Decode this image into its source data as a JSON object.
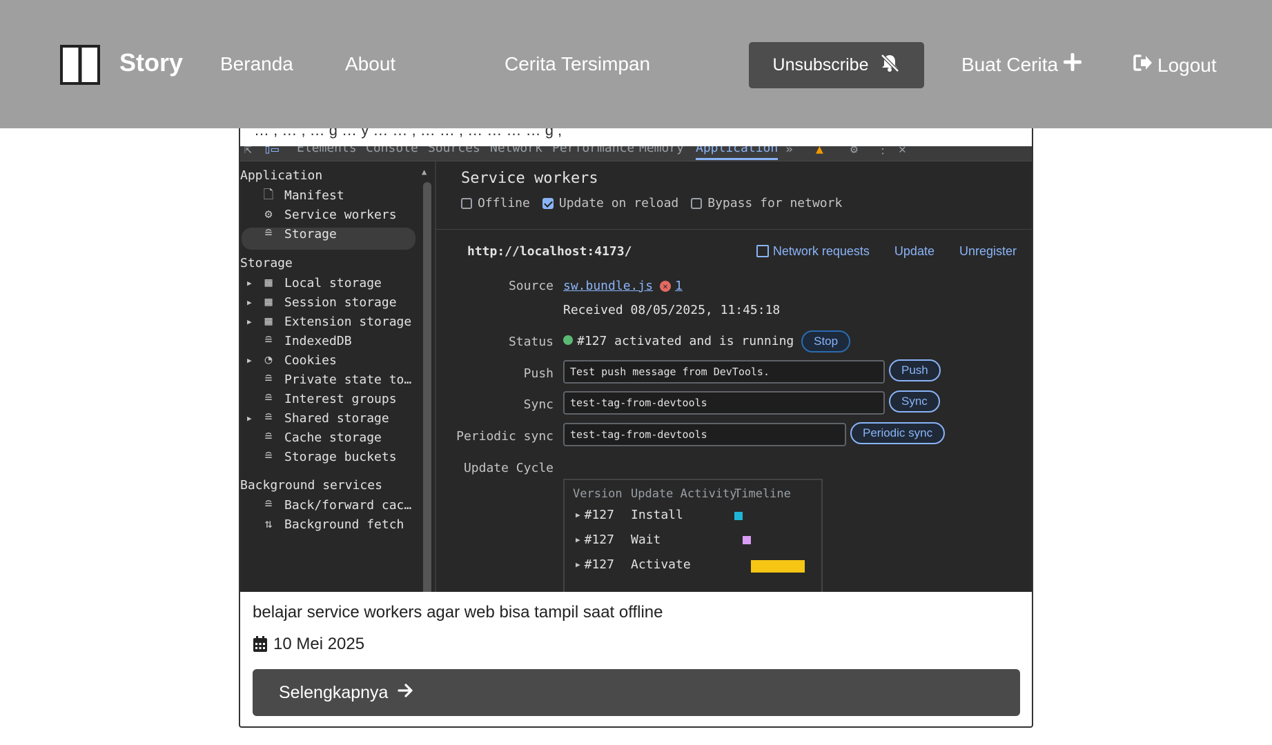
{
  "header": {
    "brand": "Story",
    "nav": [
      "Beranda",
      "About",
      "Cerita Tersimpan"
    ],
    "unsubscribe_label": "Unsubscribe",
    "create_label": "Buat Cerita",
    "logout_label": "Logout",
    "icons": {
      "logo": "book-open-icon",
      "unsubscribe": "bell-slash-icon",
      "create": "plus-icon",
      "logout": "sign-out-icon"
    },
    "colors": {
      "header_bg": "#9f9f9f",
      "button_bg": "#4d4d4d",
      "text": "#ffffff"
    }
  },
  "card": {
    "overflow_text": "… , … , … g … y … … , … … , … … … … g ,",
    "screenshot": {
      "devtools_tabs": [
        "Elements",
        "Console",
        "Sources",
        "Network",
        "Performance",
        "Memory",
        "Application"
      ],
      "active_tab": "Application",
      "sidebar": {
        "sections": [
          {
            "title": "Application",
            "items": [
              {
                "label": "Manifest",
                "icon": "file-icon"
              },
              {
                "label": "Service workers",
                "icon": "gears-icon",
                "selected": true
              },
              {
                "label": "Storage",
                "icon": "database-icon"
              }
            ]
          },
          {
            "title": "Storage",
            "items": [
              {
                "label": "Local storage",
                "icon": "table-icon",
                "expandable": true
              },
              {
                "label": "Session storage",
                "icon": "table-icon",
                "expandable": true
              },
              {
                "label": "Extension storage",
                "icon": "table-icon",
                "expandable": true
              },
              {
                "label": "IndexedDB",
                "icon": "database-icon"
              },
              {
                "label": "Cookies",
                "icon": "cookie-icon",
                "expandable": true
              },
              {
                "label": "Private state to…",
                "icon": "database-icon"
              },
              {
                "label": "Interest groups",
                "icon": "database-icon"
              },
              {
                "label": "Shared storage",
                "icon": "database-icon",
                "expandable": true
              },
              {
                "label": "Cache storage",
                "icon": "database-icon"
              },
              {
                "label": "Storage buckets",
                "icon": "database-icon"
              }
            ]
          },
          {
            "title": "Background services",
            "items": [
              {
                "label": "Back/forward cac…",
                "icon": "database-icon"
              },
              {
                "label": "Background fetch",
                "icon": "arrows-up-down-icon"
              }
            ]
          }
        ]
      },
      "panel": {
        "title": "Service workers",
        "checkboxes": [
          {
            "label": "Offline",
            "checked": false
          },
          {
            "label": "Update on reload",
            "checked": true
          },
          {
            "label": "Bypass for network",
            "checked": false
          }
        ],
        "origin": "http://localhost:4173/",
        "links": [
          "Network requests",
          "Update",
          "Unregister"
        ],
        "source_label": "Source",
        "source_file": "sw.bundle.js",
        "source_errors": "1",
        "received": "Received 08/05/2025, 11:45:18",
        "status_label": "Status",
        "status_text": "#127 activated and is running",
        "stop_label": "Stop",
        "push_label": "Push",
        "push_value": "Test push message from DevTools.",
        "push_button": "Push",
        "sync_label": "Sync",
        "sync_value": "test-tag-from-devtools",
        "sync_button": "Sync",
        "periodic_label": "Periodic sync",
        "periodic_value": "test-tag-from-devtools",
        "periodic_button": "Periodic sync",
        "cycle_label": "Update Cycle",
        "cycle_headers": [
          "Version",
          "Update Activity",
          "Timeline"
        ],
        "cycle_rows": [
          {
            "version": "#127",
            "activity": "Install",
            "color": "#1fb6d6"
          },
          {
            "version": "#127",
            "activity": "Wait",
            "color": "#d99cf5"
          },
          {
            "version": "#127",
            "activity": "Activate",
            "color": "#f7c615"
          }
        ]
      }
    },
    "description": "belajar service workers agar web bisa tampil saat offline",
    "date": "10 Mei 2025",
    "more_label": "Selengkapnya"
  }
}
